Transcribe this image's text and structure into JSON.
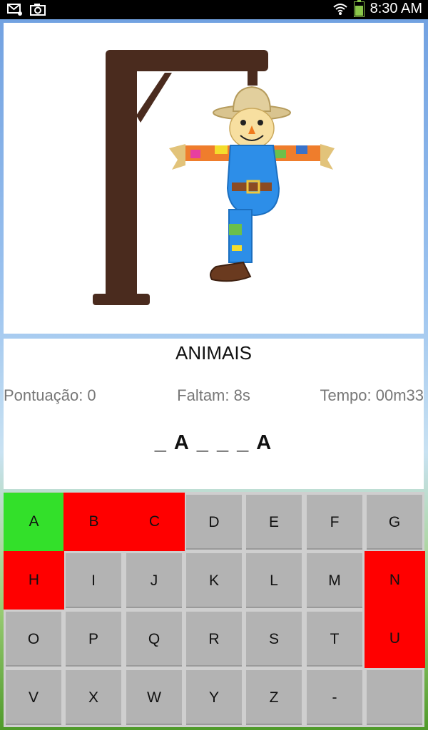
{
  "status_bar": {
    "time": "8:30 AM",
    "left_icons": [
      "mail-icon",
      "camera-icon"
    ],
    "right_icons": [
      "wifi-icon",
      "battery-icon"
    ]
  },
  "game": {
    "category": "ANIMAIS",
    "score_text": "Pontuação: 0",
    "remaining_text": "Faltam: 8s",
    "time_text": "Tempo: 00m33",
    "word_display": "_A___A"
  },
  "colors": {
    "correct": "#33e02a",
    "wrong": "#ff0000",
    "key_default": "#b3b3b3",
    "gallows": "#4a2b1e"
  },
  "keyboard": {
    "keys": [
      {
        "label": "A",
        "state": "correct"
      },
      {
        "label": "B",
        "state": "wrong"
      },
      {
        "label": "C",
        "state": "wrong"
      },
      {
        "label": "D",
        "state": "default"
      },
      {
        "label": "E",
        "state": "default"
      },
      {
        "label": "F",
        "state": "default"
      },
      {
        "label": "G",
        "state": "default"
      },
      {
        "label": "H",
        "state": "wrong"
      },
      {
        "label": "I",
        "state": "default"
      },
      {
        "label": "J",
        "state": "default"
      },
      {
        "label": "K",
        "state": "default"
      },
      {
        "label": "L",
        "state": "default"
      },
      {
        "label": "M",
        "state": "default"
      },
      {
        "label": "N",
        "state": "wrong"
      },
      {
        "label": "O",
        "state": "default"
      },
      {
        "label": "P",
        "state": "default"
      },
      {
        "label": "Q",
        "state": "default"
      },
      {
        "label": "R",
        "state": "default"
      },
      {
        "label": "S",
        "state": "default"
      },
      {
        "label": "T",
        "state": "default"
      },
      {
        "label": "U",
        "state": "wrong"
      },
      {
        "label": "V",
        "state": "default"
      },
      {
        "label": "X",
        "state": "default"
      },
      {
        "label": "W",
        "state": "default"
      },
      {
        "label": "Y",
        "state": "default"
      },
      {
        "label": "Z",
        "state": "default"
      },
      {
        "label": "-",
        "state": "default"
      },
      {
        "label": "",
        "state": "default"
      }
    ]
  }
}
